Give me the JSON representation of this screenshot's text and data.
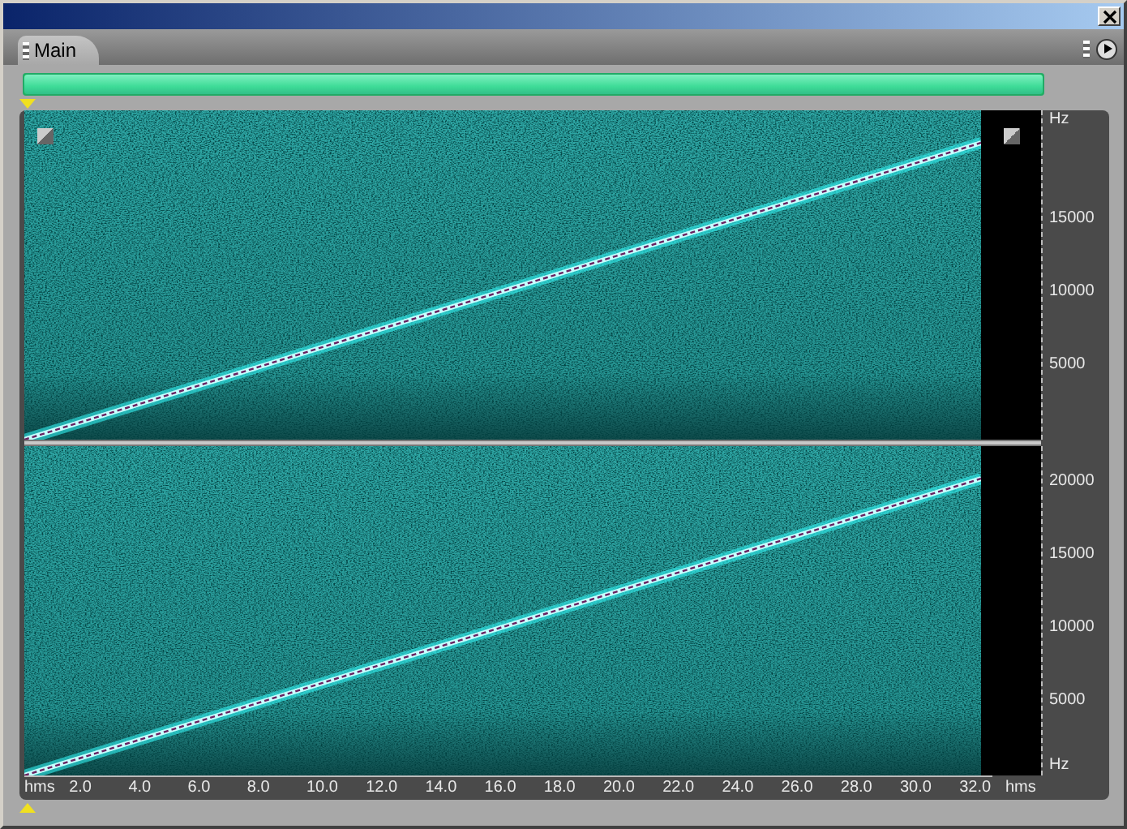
{
  "tab": {
    "label": "Main",
    "selected": true
  },
  "progress": {
    "level": 1
  },
  "channels": [
    {
      "freq_unit": "Hz",
      "freq_labels": [
        "15000",
        "10000",
        "5000"
      ]
    },
    {
      "freq_unit": "Hz",
      "freq_labels": [
        "20000",
        "15000",
        "10000",
        "5000"
      ]
    }
  ],
  "time_axis": {
    "unit_left": "hms",
    "unit_right": "hms",
    "labels": [
      "2.0",
      "4.0",
      "6.0",
      "8.0",
      "10.0",
      "12.0",
      "14.0",
      "16.0",
      "18.0",
      "20.0",
      "22.0",
      "24.0",
      "26.0",
      "28.0",
      "30.0",
      "32.0"
    ]
  }
}
